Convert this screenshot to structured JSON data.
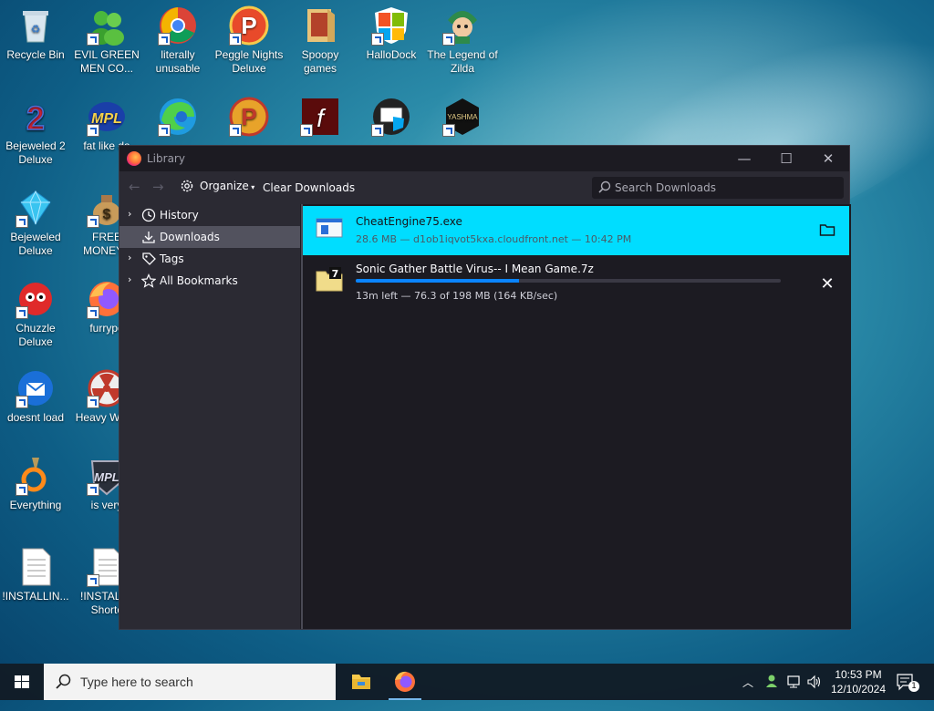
{
  "desktop": {
    "icons": [
      {
        "label": "Recycle Bin"
      },
      {
        "label": "EVIL GREEN MEN CO..."
      },
      {
        "label": "literally unusable"
      },
      {
        "label": "Peggle Nights Deluxe"
      },
      {
        "label": "Spoopy games"
      },
      {
        "label": "HalloDock"
      },
      {
        "label": "The Legend of Zilda"
      },
      {
        "label": "Bejeweled 2 Deluxe"
      },
      {
        "label": "fat like da"
      },
      {
        "label": "Bejeweled Deluxe"
      },
      {
        "label": "FREE MONEY.c"
      },
      {
        "label": "Chuzzle Deluxe"
      },
      {
        "label": "furrypo"
      },
      {
        "label": "doesnt load"
      },
      {
        "label": "Heavy Weap"
      },
      {
        "label": "Everything"
      },
      {
        "label": "is very"
      },
      {
        "label": "!INSTALLIN..."
      },
      {
        "label": "!INSTALL - Shortc"
      }
    ]
  },
  "window": {
    "title": "Library",
    "toolbar": {
      "organize": "Organize",
      "clear": "Clear Downloads",
      "search_placeholder": "Search Downloads"
    },
    "sidebar": [
      {
        "label": "History"
      },
      {
        "label": "Downloads"
      },
      {
        "label": "Tags"
      },
      {
        "label": "All Bookmarks"
      }
    ],
    "downloads": [
      {
        "name": "CheatEngine75.exe",
        "status": "28.6 MB — d1ob1iqvot5kxa.cloudfront.net — 10:42 PM"
      },
      {
        "name": "Sonic Gather Battle Virus-- I Mean Game.7z",
        "status": "13m left — 76.3 of 198 MB (164 KB/sec)",
        "progress": 0.385
      }
    ]
  },
  "taskbar": {
    "search_placeholder": "Type here to search",
    "time": "10:53 PM",
    "date": "12/10/2024",
    "notifications": "1"
  },
  "colors": {
    "selected_row": "#00ddff",
    "progress": "#0a84ff",
    "sidebar_selected": "#52525e"
  }
}
